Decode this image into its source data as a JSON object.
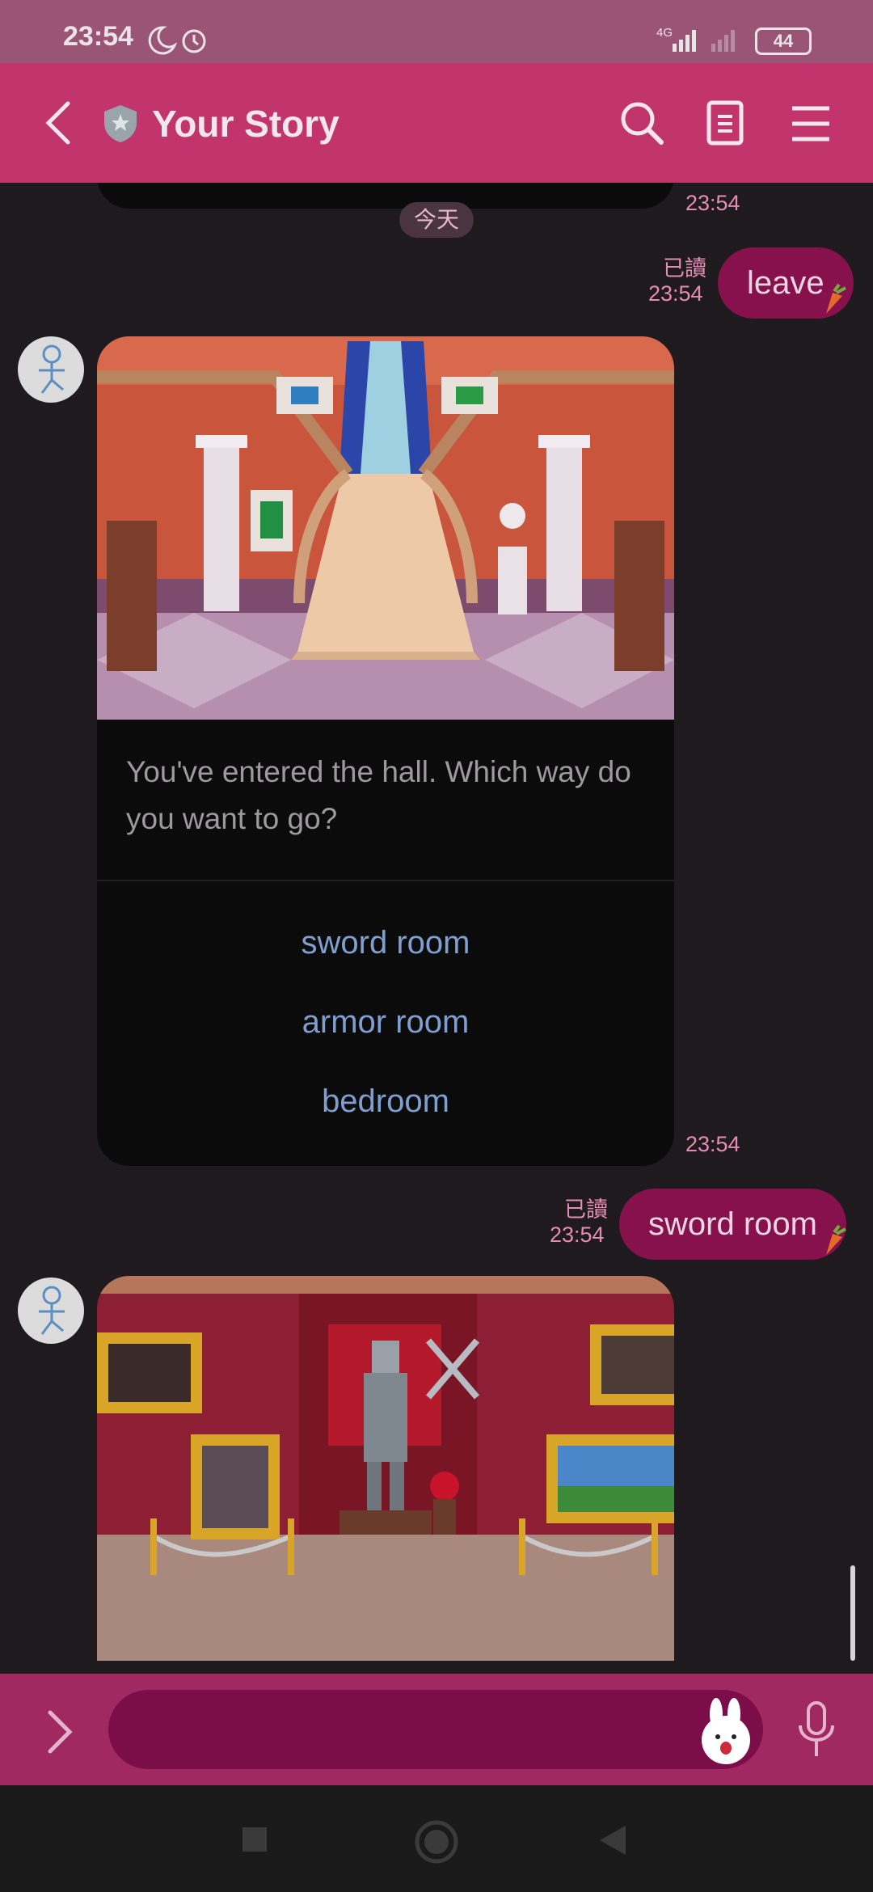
{
  "status": {
    "time": "23:54",
    "network": "4G",
    "battery": "44"
  },
  "header": {
    "title": "Your Story"
  },
  "chat": {
    "date_divider": "今天",
    "messages": [
      {
        "type": "out",
        "text": "leave",
        "read": "已讀",
        "time": "23:54"
      },
      {
        "type": "in",
        "text": "You've entered the hall. Which way do you want to go?",
        "choices": [
          "sword room",
          "armor room",
          "bedroom"
        ],
        "time": "23:54"
      },
      {
        "type": "out",
        "text": "sword room",
        "read": "已讀",
        "time": "23:54"
      }
    ],
    "first_time": "23:54"
  },
  "colors": {
    "header": "#c2346c",
    "status_bar": "#9a5576",
    "bubble_out": "#86114d",
    "background": "#1f1a1e",
    "accent_time": "#e58cb6",
    "choice_text": "#7f9fd1"
  },
  "icons": {
    "header": [
      "back-icon",
      "shield-icon",
      "search-icon",
      "notes-icon",
      "menu-icon"
    ],
    "input": [
      "expand-icon",
      "sticker-icon",
      "mic-icon"
    ],
    "nav": [
      "square-icon",
      "home-circle-icon",
      "back-triangle-icon"
    ]
  }
}
